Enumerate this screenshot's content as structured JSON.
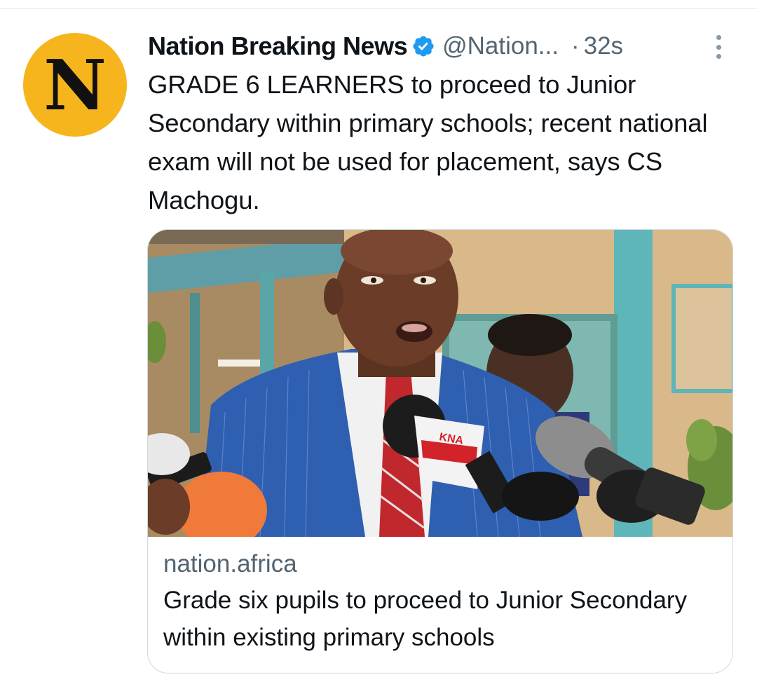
{
  "tweet": {
    "avatar_letter": "N",
    "display_name": "Nation Breaking News",
    "handle": "@Nation...",
    "separator": "·",
    "timestamp": "32s",
    "text": "GRADE 6 LEARNERS to proceed to Junior Secondary within primary schools; recent national exam will not be used for placement, says CS Machogu.",
    "icons": {
      "verified": "verified-badge-icon",
      "more": "more-options-icon"
    }
  },
  "card": {
    "image_description_icon": "news-photo",
    "domain": "nation.africa",
    "title": "Grade six pupils to proceed to Junior Secondary within existing primary schools",
    "microphone_label": "KNA"
  },
  "colors": {
    "avatar_bg": "#f6b51c",
    "verified": "#1d9bf0",
    "secondary_text": "#536471",
    "primary_text": "#0f1419",
    "card_border": "#cfd9de"
  }
}
